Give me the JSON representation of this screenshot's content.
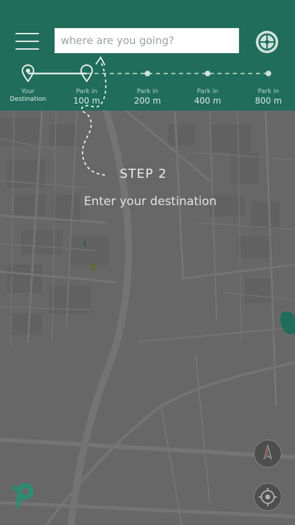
{
  "header": {
    "menu_icon": "hamburger-menu-icon",
    "search": {
      "placeholder": "where are you going?",
      "value": ""
    },
    "wheel_icon": "wheel-icon"
  },
  "steps": [
    {
      "line1": "Your",
      "line2": "Destination",
      "icon": "destination-pin-icon"
    },
    {
      "line1": "Park in",
      "line2": "100 m",
      "icon": "park-pin-icon"
    },
    {
      "line1": "Park in",
      "line2": "200 m",
      "icon": "dot-icon"
    },
    {
      "line1": "Park in",
      "line2": "400 m",
      "icon": "dot-icon"
    },
    {
      "line1": "Park in",
      "line2": "800 m",
      "icon": "dot-icon"
    }
  ],
  "overlay": {
    "step_title": "STEP 2",
    "step_text": "Enter your destination"
  },
  "map_controls": {
    "compass_icon": "compass-icon",
    "locate_icon": "locate-me-icon",
    "logo_icon": "parking-logo-icon"
  },
  "colors": {
    "header_bg": "#1f6d5a",
    "map_overlay": "#6b6b6b",
    "accent_green": "#2d8c70"
  }
}
